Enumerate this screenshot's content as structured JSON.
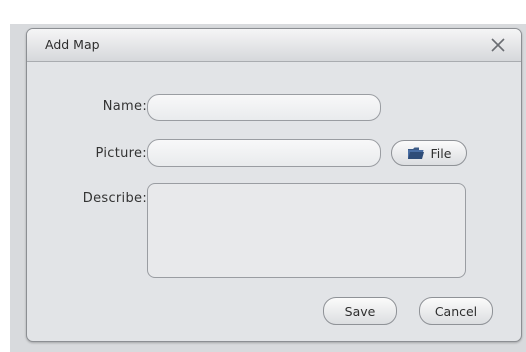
{
  "dialog": {
    "title": "Add Map",
    "close_icon": "close-icon"
  },
  "form": {
    "name_label": "Name:",
    "name_value": "",
    "picture_label": "Picture:",
    "picture_value": "",
    "file_button_label": "File",
    "file_button_icon": "folder-icon",
    "describe_label": "Describe:",
    "describe_value": ""
  },
  "actions": {
    "save_label": "Save",
    "cancel_label": "Cancel"
  }
}
